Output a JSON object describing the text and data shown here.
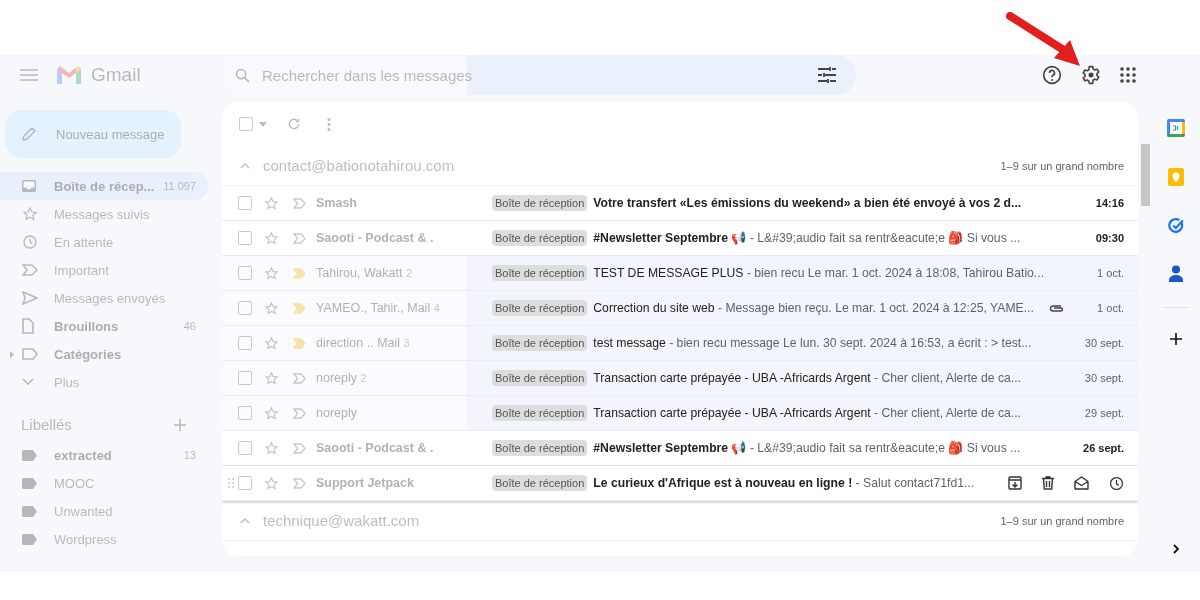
{
  "toolbar": {
    "select_all_checked": false
  },
  "header": {
    "app_name": "Gmail",
    "search": {
      "placeholder": "Rechercher dans les messages"
    }
  },
  "compose": {
    "label": "Nouveau message"
  },
  "nav": [
    {
      "kind": "inbox",
      "label": "Boîte de récep...",
      "count": "11 097",
      "selected": true,
      "bold": true
    },
    {
      "kind": "starred",
      "label": "Messages suivis",
      "selected": false,
      "bold": false
    },
    {
      "kind": "snoozed",
      "label": "En attente",
      "selected": false,
      "bold": false
    },
    {
      "kind": "important",
      "label": "Important",
      "selected": false,
      "bold": false
    },
    {
      "kind": "sent",
      "label": "Messages envoyés",
      "selected": false,
      "bold": false
    },
    {
      "kind": "drafts",
      "label": "Brouillons",
      "count": "46",
      "selected": false,
      "bold": true
    },
    {
      "kind": "categories",
      "label": "Catégories",
      "selected": false,
      "bold": true
    },
    {
      "kind": "more",
      "label": "Plus",
      "selected": false,
      "bold": false
    }
  ],
  "labels_title": "Libellés",
  "labels": [
    {
      "name": "extracted",
      "count": "13",
      "bold": true
    },
    {
      "name": "MOOC",
      "bold": false
    },
    {
      "name": "Unwanted",
      "bold": false
    },
    {
      "name": "Wordpress",
      "bold": false
    }
  ],
  "sections": [
    {
      "account": "contact@bationotahirou.com",
      "expanded": true,
      "counter": "1–9 sur un grand nombre",
      "rows": [
        {
          "sender": "Smash",
          "label": "Boîte de réception",
          "subject": "Votre transfert «Les émissions du weekend» a bien été envoyé à vos 2 d...",
          "date": "14:16",
          "unread": true,
          "important": false,
          "attachment": false,
          "hovered": false
        },
        {
          "sender": "Saooti - Podcast & .",
          "label": "Boîte de réception",
          "subject": "#Newsletter Septembre 📢",
          "snippet": "- L&#39;audio fait sa rentr&eacute;e 🎒 Si vous ...",
          "date": "09:30",
          "unread": true,
          "important": false,
          "attachment": false,
          "hovered": false
        },
        {
          "sender": "Tahirou, Wakatt",
          "count": "2",
          "label": "Boîte de réception",
          "subject": "TEST DE MESSAGE PLUS",
          "snippet": "- bien recu Le mar. 1 oct. 2024 à 18:08, Tahirou Batio...",
          "date": "1 oct.",
          "unread": false,
          "important": true,
          "attachment": false,
          "hovered": false
        },
        {
          "sender": "YAMEO., Tahir., Mail",
          "count": "4",
          "label": "Boîte de réception",
          "subject": "Correction du site web",
          "snippet": "- Message bien reçu. Le mar. 1 oct. 2024 à 12:25, YAME...",
          "date": "1 oct.",
          "unread": false,
          "important": true,
          "attachment": true,
          "hovered": false
        },
        {
          "sender": "direction .. Mail",
          "count": "3",
          "label": "Boîte de réception",
          "subject": "test message",
          "snippet": "- bien recu message Le lun. 30 sept. 2024 à 16:53, a écrit : > test...",
          "date": "30 sept.",
          "unread": false,
          "important": true,
          "attachment": false,
          "hovered": false
        },
        {
          "sender": "noreply",
          "count": "2",
          "label": "Boîte de réception",
          "subject": "Transaction carte prépayée - UBA -Africards Argent",
          "snippet": "- Cher client, Alerte de ca...",
          "date": "30 sept.",
          "unread": false,
          "important": false,
          "attachment": false,
          "hovered": false
        },
        {
          "sender": "noreply",
          "label": "Boîte de réception",
          "subject": "Transaction carte prépayée - UBA -Africards Argent",
          "snippet": "- Cher client, Alerte de ca...",
          "date": "29 sept.",
          "unread": false,
          "important": false,
          "attachment": false,
          "hovered": false
        },
        {
          "sender": "Saooti - Podcast & .",
          "label": "Boîte de réception",
          "subject": "#Newsletter Septembre 📢",
          "snippet": "- L&#39;audio fait sa rentr&eacute;e 🎒 Si vous ...",
          "date": "26 sept.",
          "unread": true,
          "important": false,
          "attachment": false,
          "hovered": false
        },
        {
          "sender": "Support Jetpack",
          "label": "Boîte de réception",
          "subject": "Le curieux d'Afrique est à nouveau en ligne !",
          "snippet": "- Salut contact71fd1...",
          "unread": true,
          "important": false,
          "attachment": false,
          "hovered": true
        }
      ]
    },
    {
      "account": "technique@wakatt.com",
      "expanded": true,
      "counter": "1–9 sur un grand nombre"
    }
  ]
}
